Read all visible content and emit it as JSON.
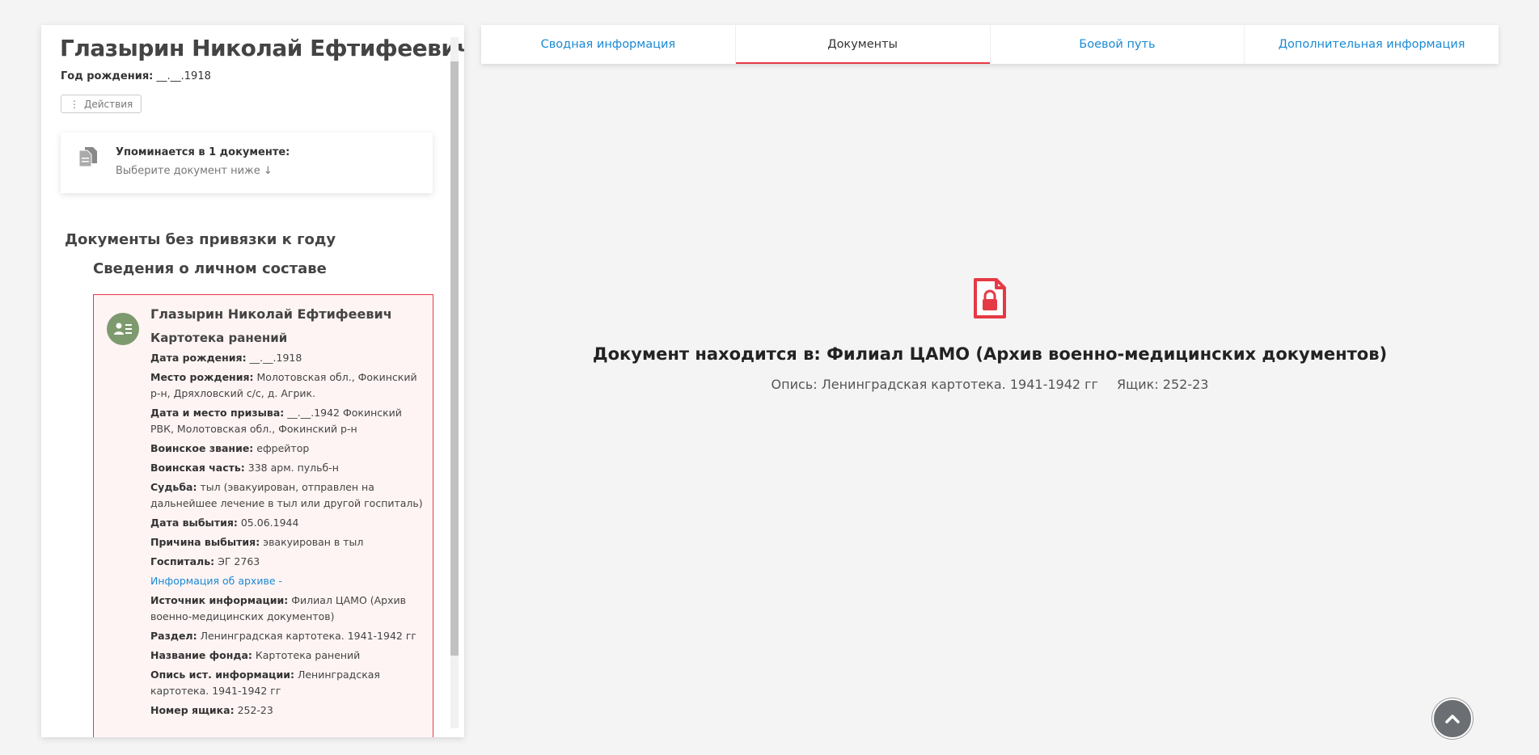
{
  "person": {
    "name": "Глазырин Николай Ефтифеевич",
    "birth_label": "Год рождения:",
    "birth_value": "__.__.1918",
    "actions_label": "Действия"
  },
  "mentions": {
    "title": "Упоминается в 1 документе:",
    "subtitle": "Выберите документ ниже ↓"
  },
  "sections": {
    "no_year_title": "Документы без привязки к году",
    "personnel_title": "Сведения о личном составе"
  },
  "document": {
    "name": "Глазырин Николай Ефтифеевич",
    "type": "Картотека ранений",
    "fields": [
      {
        "label": "Дата рождения:",
        "value": "__.__.1918"
      },
      {
        "label": "Место рождения:",
        "value": "Молотовская обл., Фокинский р-н, Дряхловский с/с, д. Агрик."
      },
      {
        "label": "Дата и место призыва:",
        "value": "__.__.1942 Фокинский РВК, Молотовская обл., Фокинский р-н"
      },
      {
        "label": "Воинское звание:",
        "value": "ефрейтор"
      },
      {
        "label": "Воинская часть:",
        "value": "338 арм. пульб-н"
      },
      {
        "label": "Судьба:",
        "value": "тыл (эвакуирован, отправлен на дальнейшее лечение в тыл или другой госпиталь)"
      },
      {
        "label": "Дата выбытия:",
        "value": "05.06.1944"
      },
      {
        "label": "Причина выбытия:",
        "value": "эвакуирован в тыл"
      },
      {
        "label": "Госпиталь:",
        "value": "ЭГ 2763"
      }
    ],
    "archive_link": "Информация об архиве -",
    "archive_fields": [
      {
        "label": "Источник информации:",
        "value": "Филиал ЦАМО (Архив военно-медицинских документов)"
      },
      {
        "label": "Раздел:",
        "value": "Ленинградская картотека. 1941-1942 гг"
      },
      {
        "label": "Название фонда:",
        "value": "Картотека ранений"
      },
      {
        "label": "Опись ист. информации:",
        "value": "Ленинградская картотека. 1941-1942 гг"
      },
      {
        "label": "Номер ящика:",
        "value": "252-23"
      }
    ]
  },
  "tabs": [
    {
      "label": "Сводная информация",
      "active": false
    },
    {
      "label": "Документы",
      "active": true
    },
    {
      "label": "Боевой путь",
      "active": false
    },
    {
      "label": "Дополнительная информация",
      "active": false
    }
  ],
  "viewer": {
    "location": "Документ находится в: Филиал ЦАМО (Архив военно-медицинских документов)",
    "inventory": "Опись: Ленинградская картотека. 1941-1942 гг",
    "box": "Ящик: 252-23"
  },
  "colors": {
    "accent_red": "#e53a45",
    "link_blue": "#1a8ad4",
    "avatar_green": "#7d9a6e"
  },
  "icons": {
    "actions": "vertical-dots-icon",
    "mentions": "documents-icon",
    "avatar": "person-card-icon",
    "locked": "locked-document-icon",
    "scroll_top": "chevron-up-icon"
  }
}
